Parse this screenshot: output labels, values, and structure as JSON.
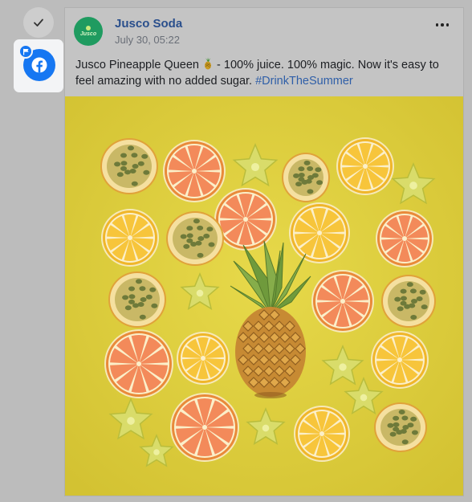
{
  "rail": {
    "check_icon": "check-icon",
    "network_icon": "facebook-icon",
    "flag_icon": "flag-icon"
  },
  "post": {
    "author_name": "Jusco Soda",
    "timestamp": "July 30, 05:22",
    "avatar_text": "Jusco",
    "text_before_emoji": "Jusco Pineapple Queen ",
    "text_after_emoji": " - 100% juice. 100% magic. Now it's easy to feel amazing with no added sugar. ",
    "hashtag": "#DrinkTheSummer",
    "emoji_icon": "pineapple-emoji",
    "more_icon": "more-options-icon"
  },
  "colors": {
    "facebook_blue": "#1677f2",
    "author_blue": "#2a4f8c",
    "hashtag_blue": "#2f5fa8",
    "avatar_green": "#1f9b60",
    "image_background": "#dccd3f"
  }
}
